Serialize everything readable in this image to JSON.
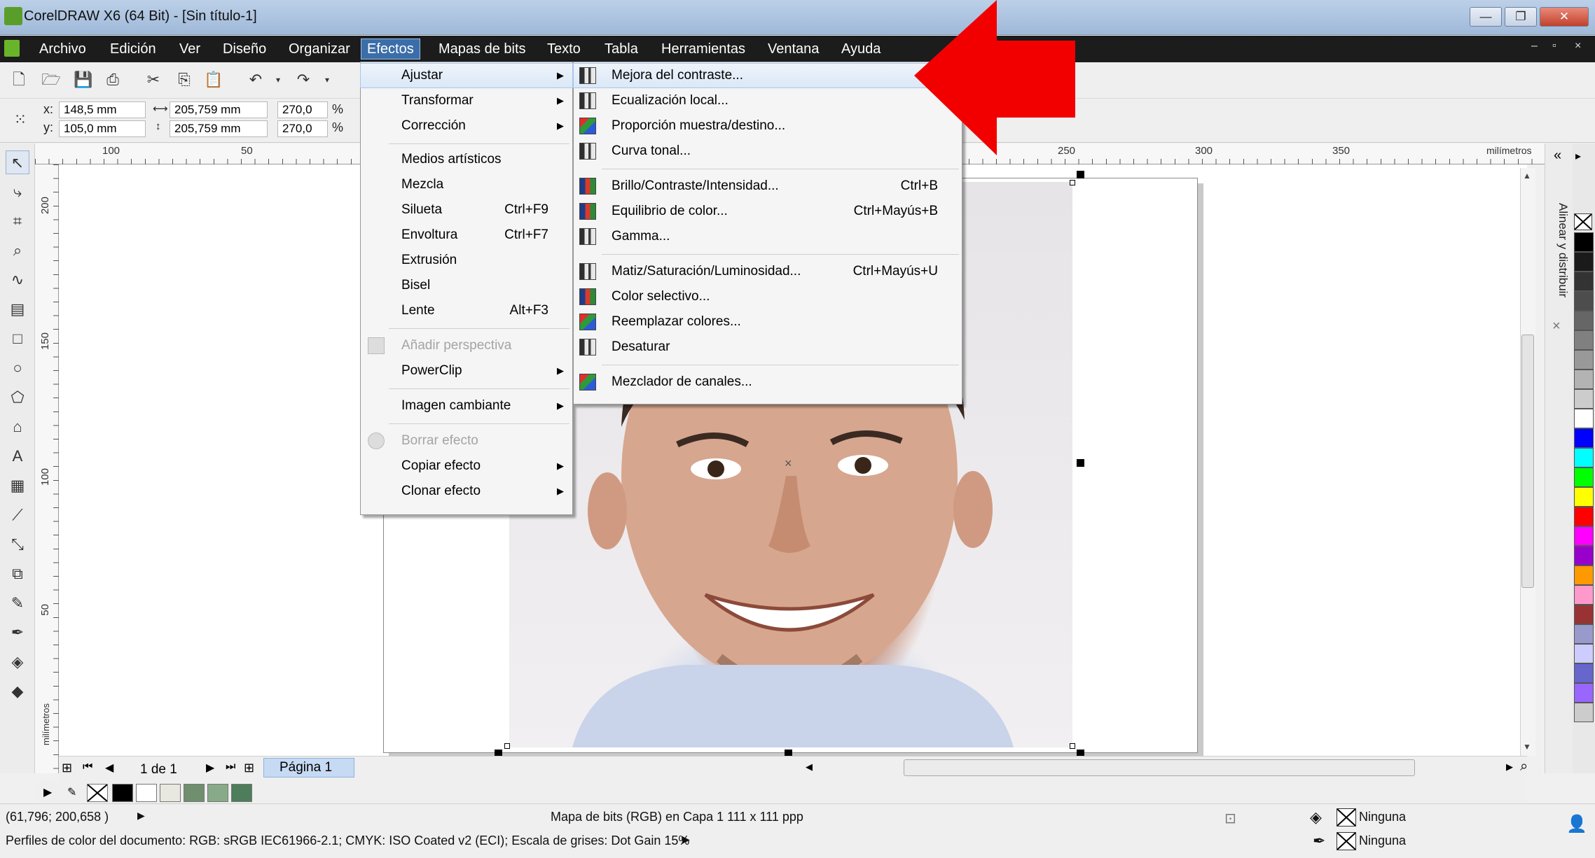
{
  "window": {
    "title": "CorelDRAW X6 (64 Bit) - [Sin título-1]",
    "minimize_symbol": "—",
    "maximize_symbol": "❐",
    "close_symbol": "✕"
  },
  "menubar": {
    "items": [
      "Archivo",
      "Edición",
      "Ver",
      "Diseño",
      "Organizar",
      "Efectos",
      "Mapas de bits",
      "Texto",
      "Tabla",
      "Herramientas",
      "Ventana",
      "Ayuda"
    ],
    "active": "Efectos",
    "mdi_controls": [
      "–",
      "▫",
      "×"
    ]
  },
  "propbar": {
    "x_label": "x:",
    "x_value": "148,5 mm",
    "y_label": "y:",
    "y_value": "105,0 mm",
    "width_value": "205,759 mm",
    "height_value": "205,759 mm",
    "scale_w": "270,0",
    "scale_h": "270,0",
    "percent": "%"
  },
  "ruler": {
    "h_ticks": [
      "100",
      "50",
      "250",
      "300",
      "350"
    ],
    "units": "milímetros",
    "v_ticks": [
      "200",
      "150",
      "100",
      "50"
    ],
    "v_units": "milímetros"
  },
  "effects_menu": {
    "items": [
      {
        "label": "Ajustar",
        "submenu": true,
        "highlight": true
      },
      {
        "label": "Transformar",
        "submenu": true
      },
      {
        "label": "Corrección",
        "submenu": true
      },
      {
        "label": "Medios artísticos"
      },
      {
        "label": "Mezcla"
      },
      {
        "label": "Silueta",
        "shortcut": "Ctrl+F9"
      },
      {
        "label": "Envoltura",
        "shortcut": "Ctrl+F7"
      },
      {
        "label": "Extrusión"
      },
      {
        "label": "Bisel"
      },
      {
        "label": "Lente",
        "shortcut": "Alt+F3"
      },
      {
        "label": "Añadir perspectiva",
        "disabled": true
      },
      {
        "label": "PowerClip",
        "submenu": true
      },
      {
        "label": "Imagen cambiante",
        "submenu": true
      },
      {
        "label": "Borrar efecto",
        "disabled": true
      },
      {
        "label": "Copiar efecto",
        "submenu": true
      },
      {
        "label": "Clonar efecto",
        "submenu": true
      }
    ]
  },
  "adjust_menu": {
    "items": [
      {
        "label": "Mejora del contraste...",
        "highlight": true
      },
      {
        "label": "Ecualización local..."
      },
      {
        "label": "Proporción muestra/destino..."
      },
      {
        "label": "Curva tonal..."
      },
      {
        "label": "Brillo/Contraste/Intensidad...",
        "shortcut": "Ctrl+B"
      },
      {
        "label": "Equilibrio de color...",
        "shortcut": "Ctrl+Mayús+B"
      },
      {
        "label": "Gamma..."
      },
      {
        "label": "Matiz/Saturación/Luminosidad...",
        "shortcut": "Ctrl+Mayús+U"
      },
      {
        "label": "Color selectivo..."
      },
      {
        "label": "Reemplazar colores..."
      },
      {
        "label": "Desaturar"
      },
      {
        "label": "Mezclador de canales..."
      }
    ]
  },
  "pagenav": {
    "counter": "1 de 1",
    "page_tab": "Página 1"
  },
  "docker": {
    "label": "Alinear y distribuir"
  },
  "status": {
    "coords": "(61,796; 200,658 )",
    "object_info": "Mapa de bits (RGB) en Capa 1 111 x 111 ppp",
    "profiles": "Perfiles de color del documento: RGB: sRGB IEC61966-2.1; CMYK: ISO Coated v2 (ECI); Escala de grises: Dot Gain 15%",
    "fill": "Ninguna",
    "outline": "Ninguna"
  },
  "colors": {
    "accent_arrow": "#f20000",
    "menu_highlight": "#3b6ea8",
    "palette": [
      "#000000",
      "#1a1a1a",
      "#333333",
      "#4d4d4d",
      "#666666",
      "#808080",
      "#999999",
      "#b3b3b3",
      "#cccccc",
      "#ffffff",
      "#0000ff",
      "#00ffff",
      "#00ff00",
      "#ffff00",
      "#ff0000",
      "#ff00ff",
      "#9900cc",
      "#ff9900",
      "#ff99cc",
      "#993333",
      "#9999cc",
      "#ccccff",
      "#6666cc",
      "#9966ff",
      "#cccccc"
    ],
    "document_swatches": [
      "#000000",
      "#ffffff",
      "#e8e8e0",
      "#6f8f6f",
      "#88aa88",
      "#4d7d5a"
    ]
  }
}
